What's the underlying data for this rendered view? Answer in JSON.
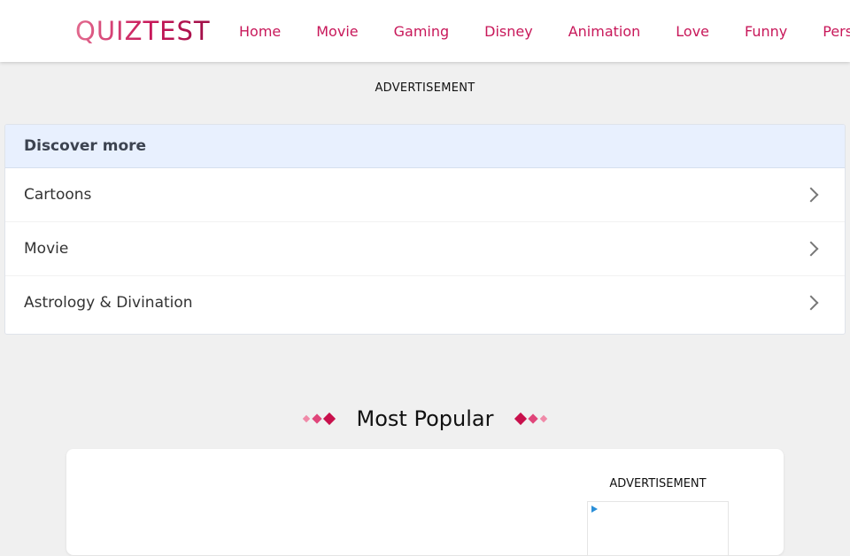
{
  "header": {
    "logo_text": "QUIZTEST",
    "nav": [
      {
        "label": "Home"
      },
      {
        "label": "Movie"
      },
      {
        "label": "Gaming"
      },
      {
        "label": "Disney"
      },
      {
        "label": "Animation"
      },
      {
        "label": "Love"
      },
      {
        "label": "Funny"
      },
      {
        "label": "Pers"
      }
    ]
  },
  "ad_label": "ADVERTISEMENT",
  "discover": {
    "title": "Discover more",
    "items": [
      {
        "label": "Cartoons",
        "icon": "chevron-right-icon"
      },
      {
        "label": "Movie",
        "icon": "chevron-right-icon"
      },
      {
        "label": "Astrology & Divination",
        "icon": "chevron-right-icon"
      }
    ]
  },
  "popular": {
    "title": "Most Popular",
    "diamond_colors": [
      "#f08aa8",
      "#e0457a",
      "#c8104c"
    ]
  },
  "card": {
    "ad_label": "ADVERTISEMENT",
    "ad_icon": "ad-choices-icon"
  },
  "colors": {
    "brand": "#c8185a",
    "discover_header_bg": "#e8f0fe",
    "page_bg": "#f0f0f0"
  }
}
